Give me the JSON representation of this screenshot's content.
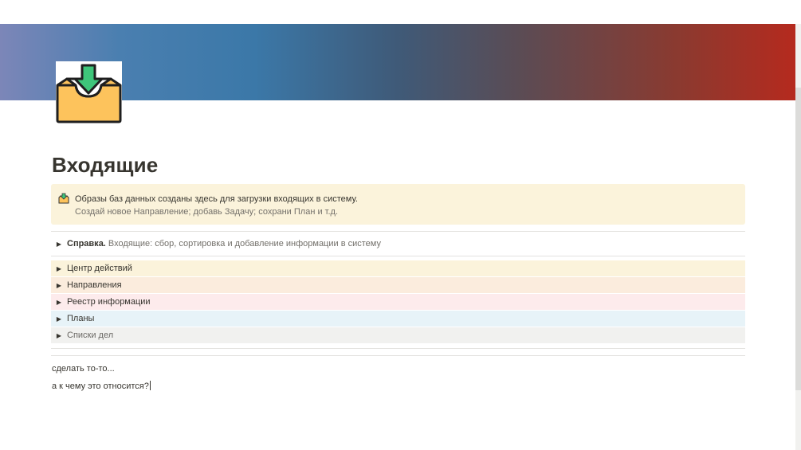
{
  "page": {
    "title": "Входящие",
    "icon": "inbox-tray-icon",
    "cover_colors": [
      "#7c86b8",
      "#3b78a8",
      "#5a4c55",
      "#b52a1e"
    ]
  },
  "callout": {
    "icon": "inbox-tray-icon",
    "line1": "Образы баз данных созданы здесь для загрузки входящих в систему.",
    "line2": "Создай новое Направление; добавь Задачу; сохрани План и т.д."
  },
  "help_toggle": {
    "bold": "Справка.",
    "text": " Входящие: сбор, сортировка и добавление информации в систему"
  },
  "toggles": [
    {
      "label": "Центр действий",
      "color": "#fbf3db"
    },
    {
      "label": "Направления",
      "color": "#fbecdd"
    },
    {
      "label": "Реестр информации",
      "color": "#fdebec"
    },
    {
      "label": "Планы",
      "color": "#e7f3f8"
    },
    {
      "label": "Списки дел",
      "color": "#f1f1ef"
    }
  ],
  "text_blocks": [
    "сделать то-то...",
    "а к чему это относится?"
  ]
}
